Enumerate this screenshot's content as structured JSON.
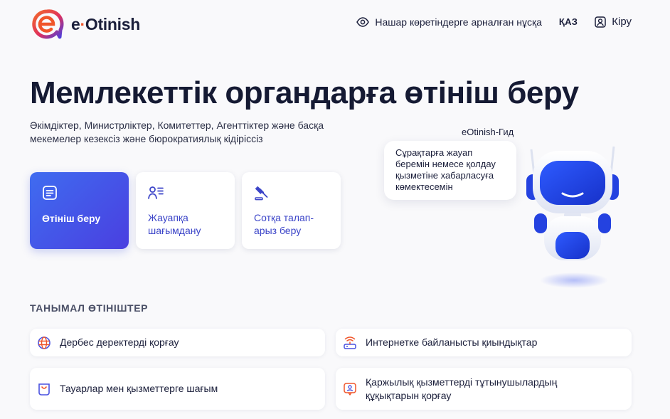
{
  "header": {
    "logo_brand_prefix": "e",
    "logo_brand_dot": "·",
    "logo_brand_name": "Otinish",
    "accessibility_label": "Нашар көретіндерге арналған нұсқа",
    "language_label": "ҚАЗ",
    "login_label": "Кіру"
  },
  "hero": {
    "title": "Мемлекеттік органдарға өтініш беру",
    "subtitle": "Әкімдіктер, Министрліктер, Комитеттер, Агенттіктер және басқа мекемелер кезексіз және бюрократиялық кідіріссіз"
  },
  "actions": [
    {
      "label": "Өтініш беру",
      "icon": "document-icon"
    },
    {
      "label": "Жауапқа шағымдану",
      "icon": "user-list-icon"
    },
    {
      "label": "Сотқа талап-арыз беру",
      "icon": "gavel-icon"
    }
  ],
  "assistant": {
    "name": "eOtinish-Гид",
    "message": "Сұрақтарға жауап беремін немесе қолдау қызметіне хабарласуға көмектесемін"
  },
  "popular": {
    "title": "ТАНЫМАЛ ӨТІНІШТЕР",
    "items": [
      {
        "label": "Дербес деректерді қорғау",
        "icon": "globe-icon"
      },
      {
        "label": "Интернетке байланысты қиындықтар",
        "icon": "router-icon"
      },
      {
        "label": "Тауарлар мен қызметтерге шағым",
        "icon": "shopping-bag-icon"
      },
      {
        "label": "Қаржылық қызметтерді тұтынушылардың құқықтарын қорғау",
        "icon": "finance-shield-icon"
      }
    ]
  },
  "colors": {
    "accent": "#4a52e0",
    "brand_orange": "#f0552a",
    "text_dark": "#151a33"
  }
}
